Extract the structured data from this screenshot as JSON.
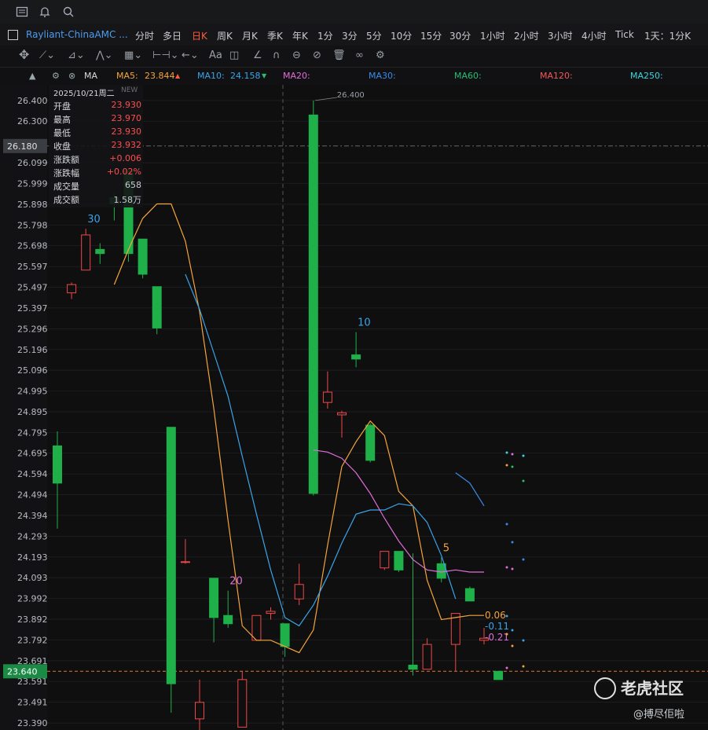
{
  "toolbar": {
    "icons": [
      "list-icon",
      "bell-icon",
      "search-icon"
    ]
  },
  "symbol": "Rayliant-ChinaAMC ...",
  "timeframes": [
    "分时",
    "多日",
    "日K",
    "周K",
    "月K",
    "季K",
    "年K",
    "1分",
    "3分",
    "5分",
    "10分",
    "15分",
    "30分",
    "1小时",
    "2小时",
    "3小时",
    "4小时",
    "Tick",
    "1天：1分K"
  ],
  "active_timeframe": "日K",
  "ma_bar": {
    "label": "MA",
    "ma5": {
      "label": "MA5:",
      "value": "23.844",
      "color": "#f5a43b"
    },
    "ma10": {
      "label": "MA10:",
      "value": "24.158",
      "color": "#3aa4e8"
    },
    "ma20": {
      "label": "MA20:",
      "value": "",
      "color": "#e06ed8"
    },
    "ma30": {
      "label": "MA30:",
      "value": "",
      "color": "#3a8be8"
    },
    "ma60": {
      "label": "MA60:",
      "value": "",
      "color": "#2bbd72"
    },
    "ma120": {
      "label": "MA120:",
      "value": "",
      "color": "#f05a5a"
    },
    "ma250": {
      "label": "MA250:",
      "value": "",
      "color": "#3ad6e0"
    }
  },
  "info_panel": {
    "date": "2025/10/21周二",
    "new_label": "NEW",
    "rows": [
      {
        "k": "开盘",
        "v": "23.930"
      },
      {
        "k": "最高",
        "v": "23.970"
      },
      {
        "k": "最低",
        "v": "23.930"
      },
      {
        "k": "收盘",
        "v": "23.932"
      },
      {
        "k": "涨跌额",
        "v": "+0.006"
      },
      {
        "k": "涨跌幅",
        "v": "+0.02%"
      },
      {
        "k": "成交量",
        "v": "658"
      },
      {
        "k": "成交额",
        "v": "1.58万"
      }
    ]
  },
  "watermark": {
    "brand": "老虎社区",
    "user": "@搏尽佢啦"
  },
  "chart_data": {
    "type": "candlestick",
    "y_ticks": [
      "26.400",
      "26.300",
      "26.180",
      "26.099",
      "25.999",
      "25.898",
      "25.798",
      "25.698",
      "25.597",
      "25.497",
      "25.397",
      "25.296",
      "25.196",
      "25.096",
      "24.995",
      "24.895",
      "24.795",
      "24.695",
      "24.594",
      "24.494",
      "24.394",
      "24.293",
      "24.193",
      "24.093",
      "23.992",
      "23.892",
      "23.792",
      "23.691",
      "23.640",
      "23.591",
      "23.491",
      "23.390"
    ],
    "ylim": [
      23.36,
      26.43
    ],
    "crosshair_price": "26.180",
    "last_price": "23.640",
    "high_label": "26.400",
    "candles": [
      {
        "o": 24.73,
        "h": 24.8,
        "l": 24.33,
        "c": 24.55
      },
      {
        "o": 25.47,
        "h": 25.52,
        "l": 25.44,
        "c": 25.51
      },
      {
        "o": 25.58,
        "h": 25.78,
        "l": 25.58,
        "c": 25.75
      },
      {
        "o": 25.68,
        "h": 25.71,
        "l": 25.61,
        "c": 25.66
      },
      {
        "o": 25.93,
        "h": 25.95,
        "l": 25.82,
        "c": 25.9
      },
      {
        "o": 26.06,
        "h": 26.06,
        "l": 25.62,
        "c": 25.66
      },
      {
        "o": 25.73,
        "h": 25.73,
        "l": 25.54,
        "c": 25.56
      },
      {
        "o": 25.5,
        "h": 25.5,
        "l": 25.27,
        "c": 25.3
      },
      {
        "o": 24.82,
        "h": 24.82,
        "l": 23.44,
        "c": 23.58
      },
      {
        "o": 24.17,
        "h": 24.28,
        "l": 24.16,
        "c": 24.17
      },
      {
        "o": 23.41,
        "h": 23.6,
        "l": 23.35,
        "c": 23.49
      },
      {
        "o": 24.09,
        "h": 24.09,
        "l": 23.78,
        "c": 23.9
      },
      {
        "o": 23.91,
        "h": 24.03,
        "l": 23.85,
        "c": 23.87
      },
      {
        "o": 23.37,
        "h": 23.64,
        "l": 23.37,
        "c": 23.6
      },
      {
        "o": 23.79,
        "h": 23.91,
        "l": 23.79,
        "c": 23.91
      },
      {
        "o": 23.92,
        "h": 23.95,
        "l": 23.89,
        "c": 23.93
      },
      {
        "o": 23.87,
        "h": 23.87,
        "l": 23.71,
        "c": 23.76
      },
      {
        "o": 23.99,
        "h": 24.16,
        "l": 23.96,
        "c": 24.06
      },
      {
        "o": 26.33,
        "h": 26.4,
        "l": 24.49,
        "c": 24.5
      },
      {
        "o": 24.94,
        "h": 25.09,
        "l": 24.91,
        "c": 24.99
      },
      {
        "o": 24.88,
        "h": 24.9,
        "l": 24.77,
        "c": 24.89
      },
      {
        "o": 25.17,
        "h": 25.28,
        "l": 25.11,
        "c": 25.15
      },
      {
        "o": 24.83,
        "h": 24.84,
        "l": 24.65,
        "c": 24.66
      },
      {
        "o": 24.14,
        "h": 24.22,
        "l": 24.13,
        "c": 24.22
      },
      {
        "o": 24.22,
        "h": 24.22,
        "l": 24.12,
        "c": 24.13
      },
      {
        "o": 23.67,
        "h": 24.21,
        "l": 23.62,
        "c": 23.65
      },
      {
        "o": 23.65,
        "h": 23.8,
        "l": 23.65,
        "c": 23.77
      },
      {
        "o": 24.16,
        "h": 24.19,
        "l": 24.07,
        "c": 24.09
      },
      {
        "o": 23.77,
        "h": 23.92,
        "l": 23.64,
        "c": 23.92
      },
      {
        "o": 24.04,
        "h": 24.05,
        "l": 23.98,
        "c": 23.98
      },
      {
        "o": 23.79,
        "h": 23.85,
        "l": 23.77,
        "c": 23.8
      },
      {
        "o": 23.64,
        "h": 23.64,
        "l": 23.63,
        "c": 23.6
      }
    ],
    "candle_annotations": [
      {
        "index": 2,
        "text": "30",
        "color": "#3aa4e8"
      },
      {
        "index": 12,
        "text": "20",
        "color": "#e06ed8"
      },
      {
        "index": 21,
        "text": "10",
        "color": "#3aa4e8"
      },
      {
        "index": 27,
        "text": "5",
        "color": "#f5a43b"
      }
    ],
    "ma5": [
      null,
      null,
      null,
      null,
      25.51,
      25.68,
      25.83,
      25.9,
      25.9,
      25.72,
      25.38,
      24.91,
      24.37,
      23.86,
      23.79,
      23.79,
      23.76,
      23.73,
      23.84,
      24.25,
      24.63,
      24.75,
      24.85,
      24.78,
      24.51,
      24.44,
      24.08,
      23.89,
      23.9,
      23.91,
      23.91
    ],
    "ma10": [
      null,
      null,
      null,
      null,
      null,
      null,
      null,
      null,
      null,
      25.56,
      25.39,
      25.18,
      24.97,
      24.68,
      24.4,
      24.13,
      23.9,
      23.86,
      23.96,
      24.1,
      24.26,
      24.4,
      24.42,
      24.42,
      24.45,
      24.44,
      24.36,
      24.2,
      23.99
    ],
    "ma20": [
      null,
      null,
      null,
      null,
      null,
      null,
      null,
      null,
      null,
      null,
      null,
      null,
      null,
      null,
      null,
      null,
      null,
      null,
      24.71,
      24.7,
      24.67,
      24.6,
      24.5,
      24.38,
      24.27,
      24.18,
      24.13,
      24.12,
      24.13,
      24.12,
      24.12
    ],
    "ma30": [
      null,
      null,
      null,
      null,
      null,
      null,
      null,
      null,
      null,
      null,
      null,
      null,
      null,
      null,
      null,
      null,
      null,
      null,
      null,
      null,
      null,
      null,
      null,
      null,
      null,
      null,
      null,
      null,
      24.6,
      24.55,
      24.44
    ],
    "ma_end_labels": [
      {
        "text": "0.06",
        "color": "#f5a43b"
      },
      {
        "text": "-0.11",
        "color": "#3aa4e8"
      },
      {
        "text": "-0.21",
        "color": "#e06ed8"
      }
    ]
  }
}
